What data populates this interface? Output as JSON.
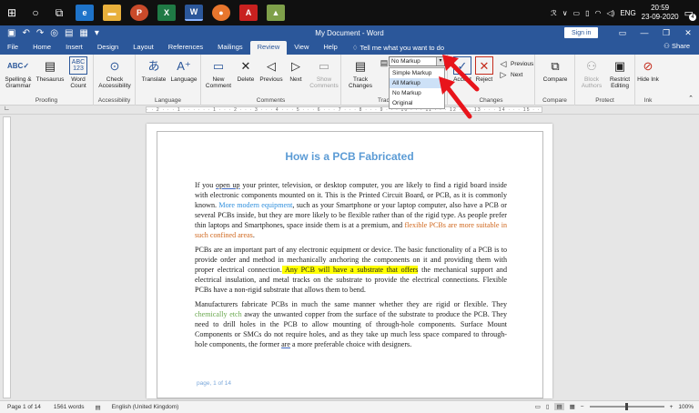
{
  "taskbar": {
    "apps": [
      {
        "name": "circle",
        "glyph": "○"
      },
      {
        "name": "task-view",
        "glyph": "⧉"
      },
      {
        "name": "edge",
        "glyph": "e",
        "color": "#1e73c9"
      },
      {
        "name": "file-explorer",
        "glyph": "▬",
        "color": "#e8b03c"
      },
      {
        "name": "powerpoint",
        "glyph": "P",
        "color": "#c94a2a"
      },
      {
        "name": "excel",
        "glyph": "X",
        "color": "#1f7a45"
      },
      {
        "name": "word",
        "glyph": "W",
        "color": "#2b579a"
      },
      {
        "name": "firefox",
        "glyph": "●",
        "color": "#e8762d"
      },
      {
        "name": "acrobat",
        "glyph": "A",
        "color": "#c8211f"
      },
      {
        "name": "photos",
        "glyph": "▲",
        "color": "#7fa04a"
      }
    ],
    "lang": "ENG",
    "time": "20:59",
    "date": "23-09-2020",
    "notif_count": "4"
  },
  "titlebar": {
    "doc_title": "My Document  -  Word",
    "signin": "Sign in"
  },
  "tabs": [
    "File",
    "Home",
    "Insert",
    "Design",
    "Layout",
    "References",
    "Mailings",
    "Review",
    "View",
    "Help"
  ],
  "tell_me": "Tell me what you want to do",
  "share": "Share",
  "ribbon": {
    "proofing": {
      "spelling": "Spelling & Grammar",
      "thesaurus": "Thesaurus",
      "word_count": "Word Count",
      "label": "Proofing"
    },
    "accessibility": {
      "check": "Check Accessibility",
      "label": "Accessibility"
    },
    "language": {
      "translate": "Translate",
      "language": "Language",
      "label": "Language"
    },
    "comments": {
      "new": "New Comment",
      "delete": "Delete",
      "previous": "Previous",
      "next": "Next",
      "show": "Show Comments",
      "label": "Comments"
    },
    "tracking": {
      "track": "Track Changes",
      "label": "Trac"
    },
    "markup_dropdown": {
      "selected": "No Markup",
      "options": [
        "Simple Markup",
        "All Markup",
        "No Markup",
        "Original"
      ],
      "highlighted": "All Markup"
    },
    "changes": {
      "accept": "Accept",
      "reject": "Reject",
      "previous": "Previous",
      "next": "Next",
      "label": "Changes"
    },
    "compare": {
      "compare": "Compare",
      "label": "Compare"
    },
    "protect": {
      "block": "Block Authors",
      "restrict": "Restrict Editing",
      "label": "Protect"
    },
    "ink": {
      "hide": "Hide Ink",
      "label": "Ink"
    }
  },
  "document": {
    "heading": "How is a PCB Fabricated",
    "p1": {
      "a": "If you ",
      "b": "open up",
      "c": " your printer, television, or desktop computer, you are likely to find a rigid board inside with electronic components mounted on it. This is the Printed Circuit Board, or PCB, as it is commonly known. ",
      "d": "More modern equipment",
      "e": ", such as your Smartphone or your laptop computer, also have a PCB or several PCBs inside, but they are more likely to be flexible rather than of the rigid type. As people prefer thin laptops and Smartphones, space inside them is at a premium, and ",
      "f": "flexible PCBs are more suitable in such confined areas",
      "g": "."
    },
    "p2": {
      "a": "PCBs are an important part of any electronic equipment or device. The basic functionality of a PCB is to provide order and method in mechanically anchoring the components on it and providing them with proper electrical connection.",
      "b": " Any PCB will have a substrate that offers",
      "c": " the mechanical support and electrical insulation, and metal tracks on the substrate to provide the electrical connections. Flexible PCBs have a non-rigid substrate that allows them to bend."
    },
    "p3": {
      "a": "Manufacturers fabricate PCBs in much the same manner whether they are rigid or flexible. They ",
      "b": "chemically etch",
      "c": " away the unwanted copper from the surface of the substrate to produce the PCB. They need to drill holes in the PCB to allow mounting of through-hole components. Surface Mount Components or SMCs do not require holes, and as they take up much less space compared to through-hole components, the former ",
      "d": "are",
      "e": " a more preferable choice with designers."
    },
    "footer": "page, 1 of 14"
  },
  "status": {
    "page": "Page 1 of 14",
    "words": "1561 words",
    "language": "English (United Kingdom)",
    "zoom": "100%"
  }
}
